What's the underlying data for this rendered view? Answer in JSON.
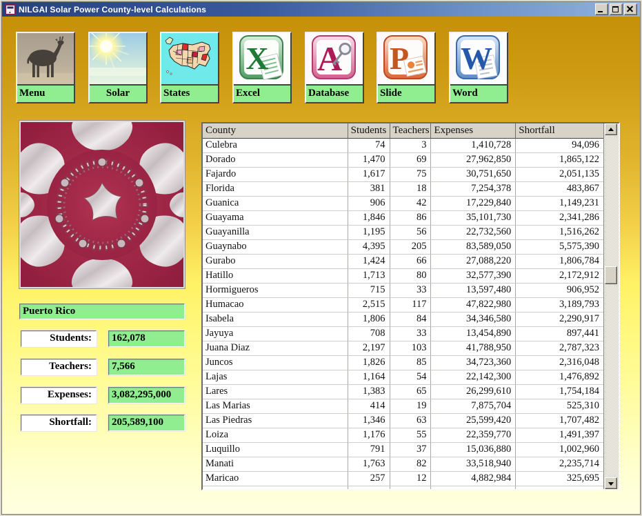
{
  "window": {
    "title": "NILGAI Solar Power County-level Calculations",
    "icon": "vb-form-icon",
    "controls": [
      {
        "name": "minimize"
      },
      {
        "name": "maximize"
      },
      {
        "name": "close"
      }
    ]
  },
  "toolbar": {
    "buttons": [
      {
        "label": "Menu",
        "icon": "nilgai-photo-icon"
      },
      {
        "label": "Solar",
        "icon": "sun-icon"
      },
      {
        "label": "States",
        "icon": "us-map-icon"
      },
      {
        "label": "Excel",
        "icon": "excel-icon"
      },
      {
        "label": "Database",
        "icon": "access-key-icon"
      },
      {
        "label": "Slide",
        "icon": "powerpoint-icon"
      },
      {
        "label": "Word",
        "icon": "word-icon"
      }
    ]
  },
  "summary": {
    "region_label": "Puerto Rico",
    "fields": [
      {
        "label": "Students:",
        "value": "162,078"
      },
      {
        "label": "Teachers:",
        "value": "7,566"
      },
      {
        "label": "Expenses:",
        "value": "3,082,295,000"
      },
      {
        "label": "Shortfall:",
        "value": "205,589,100"
      }
    ]
  },
  "table": {
    "columns": [
      "County",
      "Students",
      "Teachers",
      "Expenses",
      "Shortfall"
    ],
    "rows": [
      [
        "Culebra",
        "74",
        "3",
        "1,410,728",
        "94,096"
      ],
      [
        "Dorado",
        "1,470",
        "69",
        "27,962,850",
        "1,865,122"
      ],
      [
        "Fajardo",
        "1,617",
        "75",
        "30,751,650",
        "2,051,135"
      ],
      [
        "Florida",
        "381",
        "18",
        "7,254,378",
        "483,867"
      ],
      [
        "Guanica",
        "906",
        "42",
        "17,229,840",
        "1,149,231"
      ],
      [
        "Guayama",
        "1,846",
        "86",
        "35,101,730",
        "2,341,286"
      ],
      [
        "Guayanilla",
        "1,195",
        "56",
        "22,732,560",
        "1,516,262"
      ],
      [
        "Guaynabo",
        "4,395",
        "205",
        "83,589,050",
        "5,575,390"
      ],
      [
        "Gurabo",
        "1,424",
        "66",
        "27,088,220",
        "1,806,784"
      ],
      [
        "Hatillo",
        "1,713",
        "80",
        "32,577,390",
        "2,172,912"
      ],
      [
        "Hormigueros",
        "715",
        "33",
        "13,597,480",
        "906,952"
      ],
      [
        "Humacao",
        "2,515",
        "117",
        "47,822,980",
        "3,189,793"
      ],
      [
        "Isabela",
        "1,806",
        "84",
        "34,346,580",
        "2,290,917"
      ],
      [
        "Jayuya",
        "708",
        "33",
        "13,454,890",
        "897,441"
      ],
      [
        "Juana Diaz",
        "2,197",
        "103",
        "41,788,950",
        "2,787,323"
      ],
      [
        "Juncos",
        "1,826",
        "85",
        "34,723,360",
        "2,316,048"
      ],
      [
        "Lajas",
        "1,164",
        "54",
        "22,142,300",
        "1,476,892"
      ],
      [
        "Lares",
        "1,383",
        "65",
        "26,299,610",
        "1,754,184"
      ],
      [
        "Las Marias",
        "414",
        "19",
        "7,875,704",
        "525,310"
      ],
      [
        "Las Piedras",
        "1,346",
        "63",
        "25,599,420",
        "1,707,482"
      ],
      [
        "Loiza",
        "1,176",
        "55",
        "22,359,770",
        "1,491,397"
      ],
      [
        "Luquillo",
        "791",
        "37",
        "15,036,880",
        "1,002,960"
      ],
      [
        "Manati",
        "1,763",
        "82",
        "33,518,940",
        "2,235,714"
      ],
      [
        "Maricao",
        "257",
        "12",
        "4,882,984",
        "325,695"
      ]
    ]
  },
  "colors": {
    "accent_green": "#90EE90",
    "background_top": "#C28E06",
    "background_bottom": "#FFFFE2",
    "titlebar_left": "#26417F",
    "titlebar_right": "#93B4DE",
    "table_header_bg": "#D7D3C7",
    "fractal_crimson": "#9E2142"
  }
}
